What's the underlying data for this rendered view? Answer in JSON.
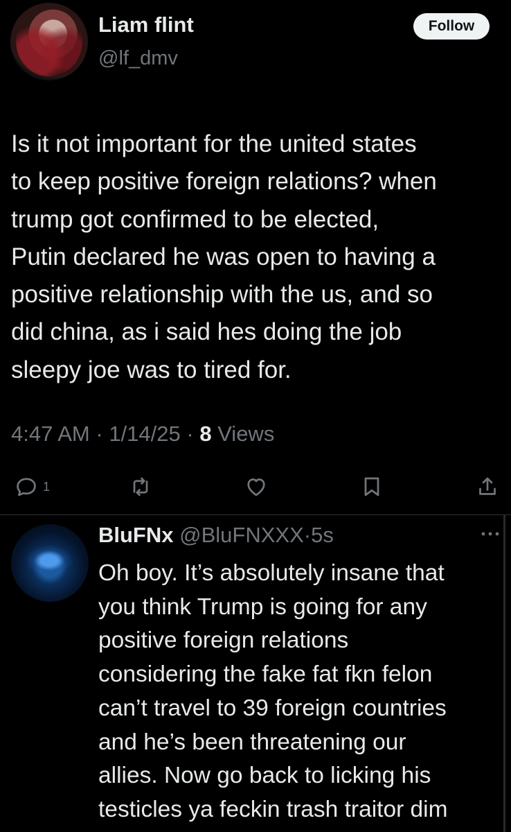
{
  "post": {
    "author_name": "Liam flint",
    "author_handle": "@lf_dmv",
    "follow_label": "Follow",
    "text": "Is it not important for the united states\nto keep positive foreign relations? when\ntrump got confirmed to be elected,\nPutin declared he was open to having a\npositive relationship with the us, and so\ndid china, as i said hes doing the job\nsleepy joe was to tired for.",
    "time": "4:47 AM",
    "date": "1/14/25",
    "views_count": "8",
    "views_label": "Views",
    "reply_count": "1",
    "icons": [
      "reply-icon",
      "retweet-icon",
      "like-icon",
      "bookmark-icon",
      "share-icon"
    ]
  },
  "reply": {
    "author_name": "BluFNx",
    "author_handle": "@BluFNXXX",
    "separator": "·",
    "time": "5s",
    "text": "Oh boy. It’s absolutely insane that\nyou think Trump is going for any\npositive foreign relations\nconsidering the fake fat fkn felon\ncan’t travel to 39 foreign countries\nand he’s been threatening our\nallies. Now go back to licking his\ntesticles ya feckin trash traitor dim",
    "icons": [
      "more-icon"
    ]
  },
  "colors": {
    "background": "#000000",
    "text": "#e7e9ea",
    "secondary_text": "#71767b",
    "follow_button_bg": "#eff3f4"
  }
}
